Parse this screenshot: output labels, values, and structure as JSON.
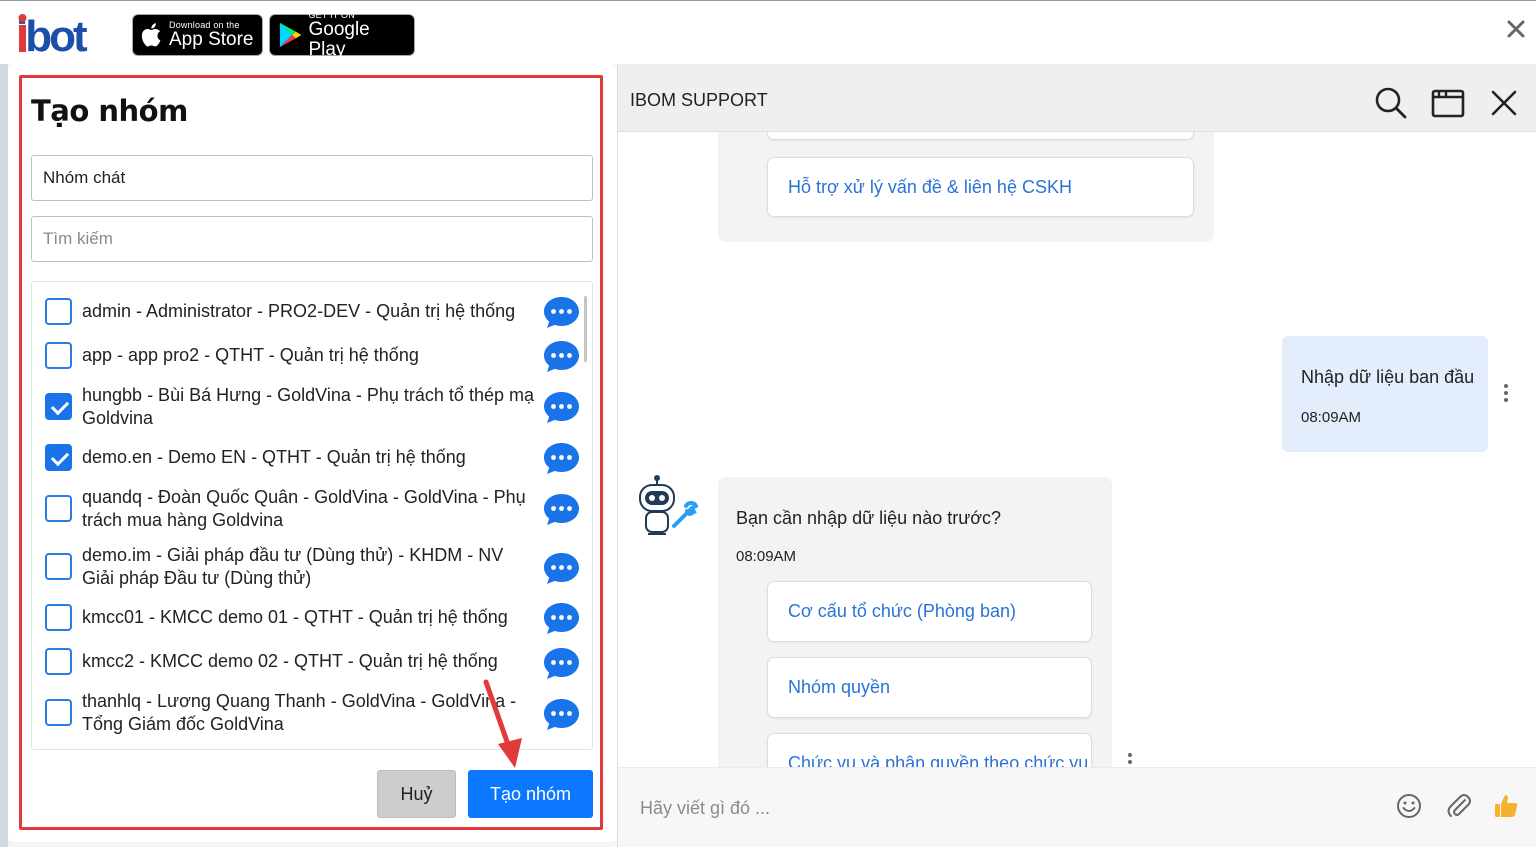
{
  "topbar": {
    "logo_text": "ibot",
    "app_store": {
      "small": "Download on the",
      "big": "App Store"
    },
    "google_play": {
      "small": "GET IT ON",
      "big": "Google Play"
    }
  },
  "modal": {
    "title": "Tạo nhóm",
    "group_name_value": "Nhóm chát",
    "search_placeholder": "Tìm kiếm",
    "members": [
      {
        "text": "admin - Administrator - PRO2-DEV - Quản trị hệ thống",
        "checked": false
      },
      {
        "text": "app - app pro2 - QTHT - Quản trị hệ thống",
        "checked": false
      },
      {
        "text": "hungbb - Bùi Bá Hưng - GoldVina - Phụ trách tổ thép mạ Goldvina",
        "checked": true
      },
      {
        "text": "demo.en - Demo EN - QTHT - Quản trị hệ thống",
        "checked": true
      },
      {
        "text": "quandq - Đoàn Quốc Quân - GoldVina - GoldVina - Phụ trách mua hàng Goldvina",
        "checked": false
      },
      {
        "text": "demo.im - Giải pháp đầu tư (Dùng thử) - KHDM - NV Giải pháp Đầu tư (Dùng thử)",
        "checked": false
      },
      {
        "text": "kmcc01 - KMCC demo 01 - QTHT - Quản trị hệ thống",
        "checked": false
      },
      {
        "text": "kmcc2 - KMCC demo 02 - QTHT - Quản trị hệ thống",
        "checked": false
      },
      {
        "text": "thanhlq - Lương Quang Thanh - GoldVina - GoldVina - Tổng Giám đốc GoldVina",
        "checked": false
      }
    ],
    "cancel_label": "Huỷ",
    "create_label": "Tạo nhóm"
  },
  "chat": {
    "title": "IBOM SUPPORT",
    "options_top": [
      "Hỗ trợ xử lý vấn đề & liên hệ CSKH"
    ],
    "user_message": {
      "text": "Nhập dữ liệu ban đầu",
      "time": "08:09AM"
    },
    "bot_message": {
      "text": "Bạn cần nhập dữ liệu nào trước?",
      "time": "08:09AM"
    },
    "options": [
      "Cơ cấu tổ chức (Phòng ban)",
      "Nhóm quyền",
      "Chức vụ và phân quyền theo chức vụ"
    ],
    "input_placeholder": "Hãy viết gì đó ...",
    "accent_color": "#0b78ff",
    "link_color": "#2a72d6"
  }
}
